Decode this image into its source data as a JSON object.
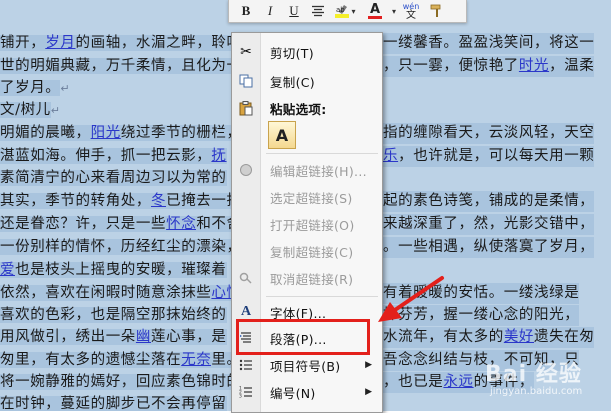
{
  "document": {
    "lines": [
      {
        "t": "铺开，",
        "link": "岁月",
        "r": "的画轴，水湄之畔，聆听",
        "tail": "一缕馨香。盈盈浅笑间，将这一"
      },
      {
        "t": "世的明媚典藏，万千柔情，且化为一",
        "link": "",
        "r": "",
        "tail": "，只一霎，便惊艳了",
        "link2": "时光",
        "r2": "，温柔"
      },
      {
        "t": "了岁月。",
        "mark": "↵"
      },
      {
        "t": "文/树儿",
        "mark": "↵"
      },
      {
        "t": "明媚的晨曦，",
        "link": "阳光",
        "r": "绕过季节的栅栏，",
        "tail": "指的缠隙看天，云淡风轻，天空"
      },
      {
        "t": "湛蓝如海。伸手，抓一把云影，",
        "link": "抚",
        "r": "",
        "tail": "乐",
        "tail2": "，也许就是，可以每天用一颗"
      },
      {
        "t": "素简清宁的心来看周边习以为常的",
        "tail": ""
      },
      {
        "t": "其实，季节的转角处，",
        "link": "冬",
        "r": "已掩去一抹",
        "tail": "起的素色诗笺，铺成的是柔情，"
      },
      {
        "t": "还是眷恋？许，只是一些",
        "link": "怀念",
        "r": "和不舍",
        "tail": "来越深重了，然，光影交错中，"
      },
      {
        "t": "一份别样的情怀，历经红尘的漂染，",
        "tail": "。一些相遇，纵使落寞了岁月，"
      },
      {
        "t": "爱",
        "r": "也是枝头上摇曳的安暖，璀璨着",
        "tail": ""
      },
      {
        "t": "依然，喜欢在闲暇时随意涂抹些",
        "link": "心情",
        "tail": "有着暖暖的安恬。一缕浅绿是"
      },
      {
        "t": "喜欢的色彩，也是隔空那抹始终的",
        "tail": "抹芬芳，握一缕心念的阳光，"
      },
      {
        "t": "用风做引，绣出一朵",
        "link": "幽",
        "r": "莲心事，是",
        "tail": "水流年，有太多的",
        "link2": "美好",
        "r2": "遗失在匆"
      },
      {
        "t": "匆里，有太多的遗憾尘落在",
        "link": "无奈",
        "r": "里。",
        "tail": "吾念念纠结与枝，不可知，只"
      },
      {
        "t": "将一婉静雅的嫣好，回应素色锦时的",
        "tail": "，也已是",
        "link2": "永远",
        "r2": "的事件，"
      },
      {
        "t": "在时钟，蔓延的脚步已不会再停留",
        "tail": ""
      }
    ]
  },
  "toolbar": {
    "bold": "B",
    "italic": "I",
    "underline": "U",
    "align_icon": "center-align-icon",
    "highlight_icon": "highlighter-icon",
    "font_color_label": "A",
    "font_color": "#e02020",
    "phonetic_top": "wén",
    "phonetic_bottom": "文",
    "format_painter_icon": "brush-icon"
  },
  "menu": {
    "cut": "剪切(T)",
    "copy": "复制(C)",
    "paste_options": "粘贴选项:",
    "paste_keep": "A",
    "edit_hyperlink": "编辑超链接(H)...",
    "select_hyperlink": "选定超链接(S)",
    "open_hyperlink": "打开超链接(O)",
    "copy_hyperlink": "复制超链接(C)",
    "remove_hyperlink": "取消超链接(R)",
    "font": "字体(F)...",
    "paragraph": "段落(P)...",
    "bullets": "项目符号(B)",
    "numbering": "编号(N)"
  },
  "watermark": {
    "brand": "Bai 经验",
    "sub": "jingyan.baidu.com"
  },
  "colors": {
    "selection": "#a9c4de",
    "highlight_box": "#e3201b",
    "link": "#2b37c9"
  }
}
